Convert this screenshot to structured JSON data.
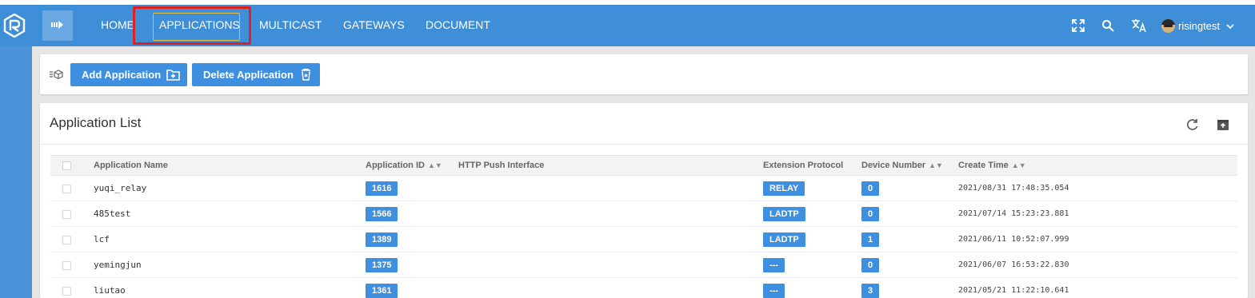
{
  "header": {
    "nav": [
      "HOME",
      "APPLICATIONS",
      "MULTICAST",
      "GATEWAYS",
      "DOCUMENT"
    ],
    "username": "risingtest",
    "colors": {
      "bar": "#3e8ed8",
      "active_border": "#e5c04a",
      "highlight": "#e02020"
    }
  },
  "toolbar": {
    "add_label": "Add Application",
    "delete_label": "Delete Application"
  },
  "list": {
    "title": "Application List",
    "columns": [
      "Application Name",
      "Application ID",
      "HTTP Push Interface",
      "Extension Protocol",
      "Device Number",
      "Create Time"
    ],
    "sortable": [
      "Application ID",
      "Device Number",
      "Create Time"
    ],
    "rows": [
      {
        "name": "yuqi_relay",
        "id": "1616",
        "http": "",
        "protocol": "RELAY",
        "devices": "0",
        "created": "2021/08/31 17:48:35.054"
      },
      {
        "name": "485test",
        "id": "1566",
        "http": "",
        "protocol": "LADTP",
        "devices": "0",
        "created": "2021/07/14 15:23:23.881"
      },
      {
        "name": "lcf",
        "id": "1389",
        "http": "",
        "protocol": "LADTP",
        "devices": "1",
        "created": "2021/06/11 10:52:07.999"
      },
      {
        "name": "yemingjun",
        "id": "1375",
        "http": "",
        "protocol": "---",
        "devices": "0",
        "created": "2021/06/07 16:53:22.830"
      },
      {
        "name": "liutao",
        "id": "1361",
        "http": "",
        "protocol": "---",
        "devices": "3",
        "created": "2021/05/21 11:22:10.641"
      }
    ]
  },
  "icons": {
    "logo": "app-logo",
    "menu_toggle": "menu-toggle-icon",
    "fullscreen": "fullscreen-icon",
    "search": "search-icon",
    "translate": "translate-icon",
    "dropdown": "chevron-down-icon",
    "refresh": "refresh-icon",
    "export": "export-icon"
  }
}
